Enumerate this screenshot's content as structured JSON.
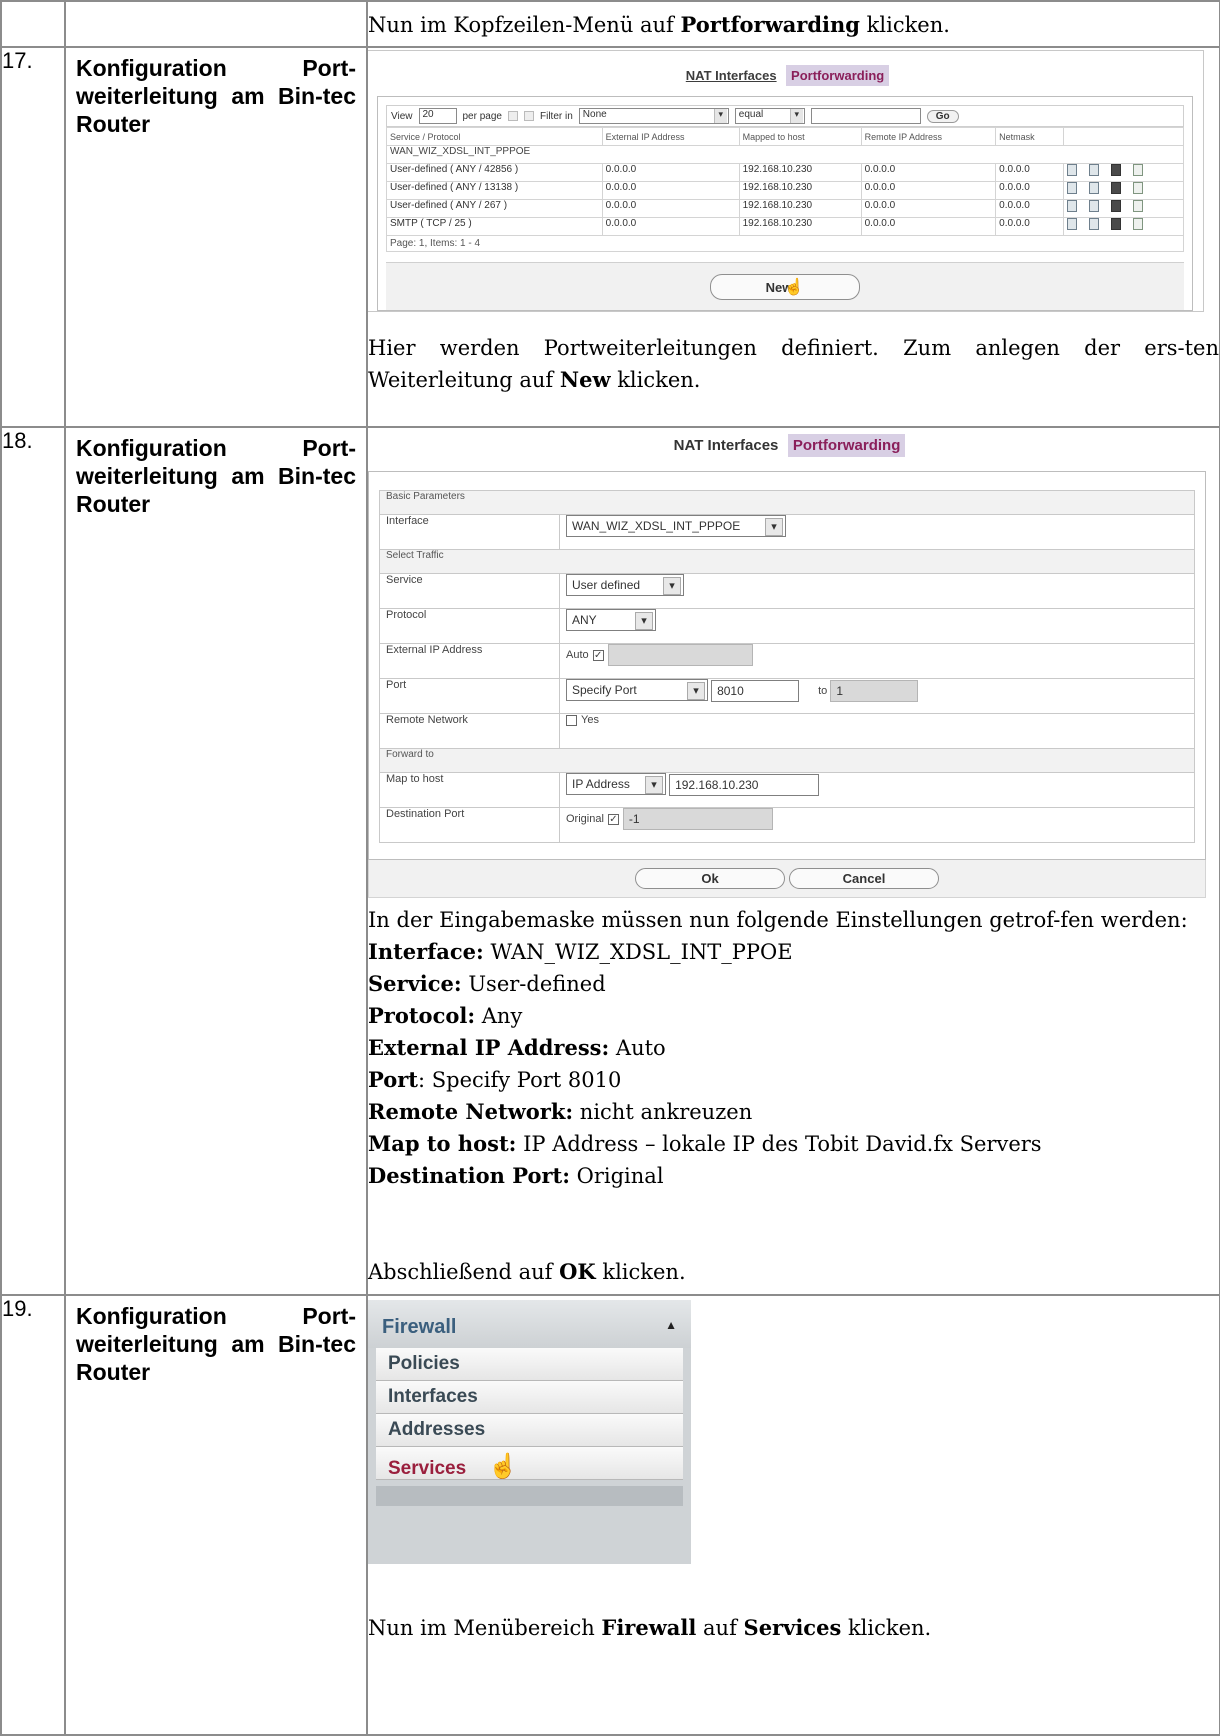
{
  "row_intro": {
    "text_prefix": "Nun im Kopfzeilen-Menü auf ",
    "text_bold": "Portforwarding",
    "text_suffix": " klicken."
  },
  "step17": {
    "number": "17.",
    "title": "Konfiguration Port-weiterleitung am Bin-tec Router",
    "tabs": [
      "NAT Interfaces",
      "Portforwarding"
    ],
    "toolbar": {
      "view_label": "View",
      "view_value": "20",
      "per_page": "per page",
      "filter_label": "Filter in",
      "filter_value": "None",
      "op_value": "equal",
      "go": "Go"
    },
    "columns": [
      "Service / Protocol",
      "External IP Address",
      "Mapped to host",
      "Remote IP Address",
      "Netmask"
    ],
    "group": "WAN_WIZ_XDSL_INT_PPPOE",
    "rows": [
      [
        "User-defined ( ANY / 42856 )",
        "0.0.0.0",
        "192.168.10.230",
        "0.0.0.0",
        "0.0.0.0"
      ],
      [
        "User-defined ( ANY / 13138 )",
        "0.0.0.0",
        "192.168.10.230",
        "0.0.0.0",
        "0.0.0.0"
      ],
      [
        "User-defined ( ANY / 267 )",
        "0.0.0.0",
        "192.168.10.230",
        "0.0.0.0",
        "0.0.0.0"
      ],
      [
        "SMTP ( TCP / 25 )",
        "0.0.0.0",
        "192.168.10.230",
        "0.0.0.0",
        "0.0.0.0"
      ]
    ],
    "pager": "Page: 1, Items: 1 - 4",
    "new_button": "New",
    "caption_part1": "Hier werden Portweiterleitungen definiert. Zum anlegen der ers-ten Weiterleitung auf ",
    "caption_bold": "New",
    "caption_part2": " klicken."
  },
  "step18": {
    "number": "18.",
    "title": "Konfiguration Port-weiterleitung am Bin-tec Router",
    "tabs": [
      "NAT Interfaces",
      "Portforwarding"
    ],
    "sections": {
      "basic": "Basic Parameters",
      "traffic": "Select Traffic",
      "forward": "Forward to"
    },
    "fields": {
      "interface_label": "Interface",
      "interface_value": "WAN_WIZ_XDSL_INT_PPPOE",
      "service_label": "Service",
      "service_value": "User defined",
      "protocol_label": "Protocol",
      "protocol_value": "ANY",
      "ext_ip_label": "External IP Address",
      "ext_ip_auto": "Auto",
      "port_label": "Port",
      "port_mode": "Specify Port",
      "port_value": "8010",
      "port_to_label": "to",
      "port_to_value": "1",
      "remote_label": "Remote Network",
      "remote_yes": "Yes",
      "map_label": "Map to host",
      "map_mode": "IP Address",
      "map_value": "192.168.10.230",
      "dest_label": "Destination Port",
      "dest_original": "Original",
      "dest_value": "-1"
    },
    "ok_button": "Ok",
    "cancel_button": "Cancel",
    "intro": "In der Eingabemaske müssen nun folgende Einstellungen getrof-fen werden:",
    "settings": [
      {
        "label": "Interface:",
        "value": " WAN_WIZ_XDSL_INT_PPOE"
      },
      {
        "label": "Service:",
        "value": " User-defined"
      },
      {
        "label": "Protocol:",
        "value": " Any"
      },
      {
        "label": "External IP Address:",
        "value": " Auto"
      },
      {
        "label": "Port",
        "value": ": Specify Port 8010"
      },
      {
        "label": "Remote Network:",
        "value": " nicht ankreuzen"
      },
      {
        "label": "Map to host:",
        "value": " IP Address – lokale IP des Tobit David.fx Servers"
      },
      {
        "label": "Destination Port:",
        "value": " Original"
      }
    ],
    "closing_prefix": "Abschließend auf ",
    "closing_bold": "OK",
    "closing_suffix": " klicken."
  },
  "step19": {
    "number": "19.",
    "title": "Konfiguration Port-weiterleitung am Bin-tec Router",
    "menu_header": "Firewall",
    "menu_items": [
      "Policies",
      "Interfaces",
      "Addresses",
      "Services"
    ],
    "caption_prefix": "Nun im Menübereich ",
    "caption_bold1": "Firewall",
    "caption_mid": " auf ",
    "caption_bold2": "Services",
    "caption_suffix": " klicken."
  }
}
